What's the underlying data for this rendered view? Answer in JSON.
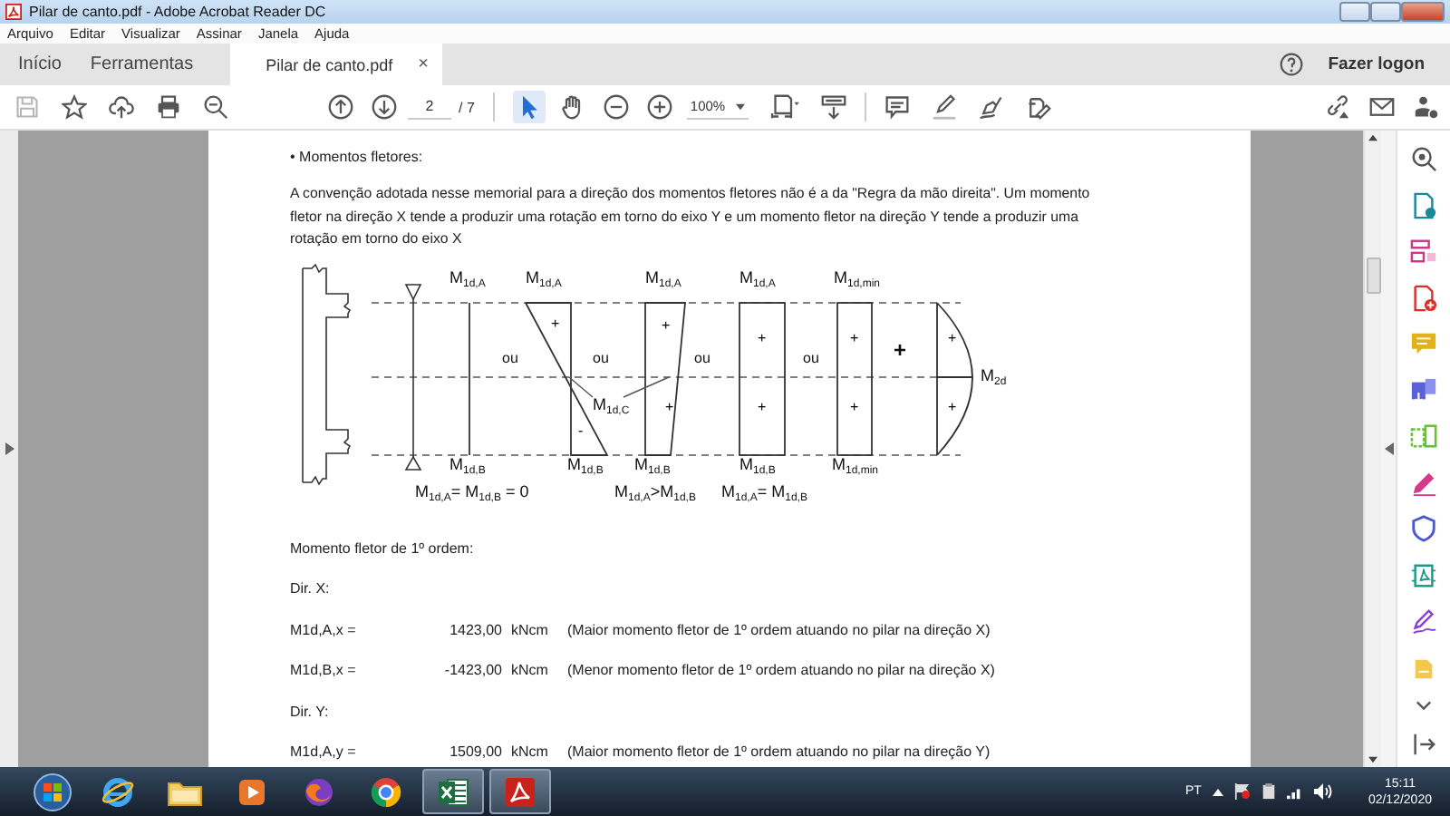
{
  "window": {
    "title": "Pilar de canto.pdf - Adobe Acrobat Reader DC"
  },
  "menu": [
    "Arquivo",
    "Editar",
    "Visualizar",
    "Assinar",
    "Janela",
    "Ajuda"
  ],
  "tabs": [
    {
      "label": "Início",
      "selected": false
    },
    {
      "label": "Ferramentas",
      "selected": false
    },
    {
      "label": "Pilar de canto.pdf",
      "selected": true,
      "close": "×"
    }
  ],
  "account": "Fazer logon",
  "toolbar": {
    "page": "2",
    "page_total": "/ 7",
    "zoom": "100%",
    "pointer_tools": [
      {
        "kind": "select",
        "selected": true
      },
      {
        "kind": "hand",
        "selected": false
      }
    ]
  },
  "document": {
    "heading": "• Momentos fletores:",
    "paragraph": "A convenção adotada nesse memorial para a direção dos momentos fletores não é a da \"Regra da mão direita\". Um momento fletor na direção X tende a produzir uma rotação em torno do eixo Y e um momento fletor na direção Y tende a produzir uma rotação em torno do eixo X",
    "figure": {
      "top_labels": [
        "M$_{1d,A}$",
        "M$_{1d,A}$",
        "M$_{1d,A}$",
        "M$_{1d,A}$",
        "M$_{1d,min}$"
      ],
      "between": [
        "ou",
        "ou",
        "ou",
        "ou",
        "+"
      ],
      "side_label": "M$_{2d}$",
      "cross_label": "M$_{1d,C}$",
      "signs": [
        "+",
        "+",
        "+",
        "+",
        "+",
        "+",
        "+",
        "+",
        "+",
        "-"
      ],
      "bottom_labels": [
        "M$_{1d,B}$",
        "M$_{1d,B}$",
        "M$_{1d,B}$",
        "M$_{1d,B}$",
        "M$_{1d,min}$"
      ],
      "conditions": [
        "M$_{1d,A}$= M$_{1d,B}$ = 0",
        "M$_{1d,A}$>M$_{1d,B}$",
        "M$_{1d,A}$= M$_{1d,B}$"
      ]
    },
    "subheading": "Momento fletor de 1º ordem:",
    "blocks": [
      {
        "kind": "heading",
        "text": "Dir. X:"
      },
      {
        "kind": "row",
        "label": "M1d,A,x =",
        "value": "1423,00",
        "unit": "kNcm",
        "note": "(Maior momento fletor de 1º ordem atuando no pilar na direção X)"
      },
      {
        "kind": "row",
        "label": "M1d,B,x =",
        "value": "-1423,00",
        "unit": "kNcm",
        "note": "(Menor momento fletor de 1º ordem atuando no pilar na direção X)"
      },
      {
        "kind": "heading",
        "text": "Dir. Y:"
      },
      {
        "kind": "row",
        "label": "M1d,A,y =",
        "value": "1509,00",
        "unit": "kNcm",
        "note": "(Maior momento fletor de 1º ordem atuando no pilar na direção Y)"
      }
    ]
  },
  "taskbar": {
    "apps": [
      {
        "kind": "ie",
        "open": false
      },
      {
        "kind": "folder",
        "open": false
      },
      {
        "kind": "media",
        "open": false
      },
      {
        "kind": "firefox",
        "open": false
      },
      {
        "kind": "chrome",
        "open": false
      },
      {
        "kind": "excel",
        "open": true
      },
      {
        "kind": "pdf",
        "open": true
      }
    ],
    "language": "PT",
    "time": "15:11",
    "date": "02/12/2020"
  }
}
